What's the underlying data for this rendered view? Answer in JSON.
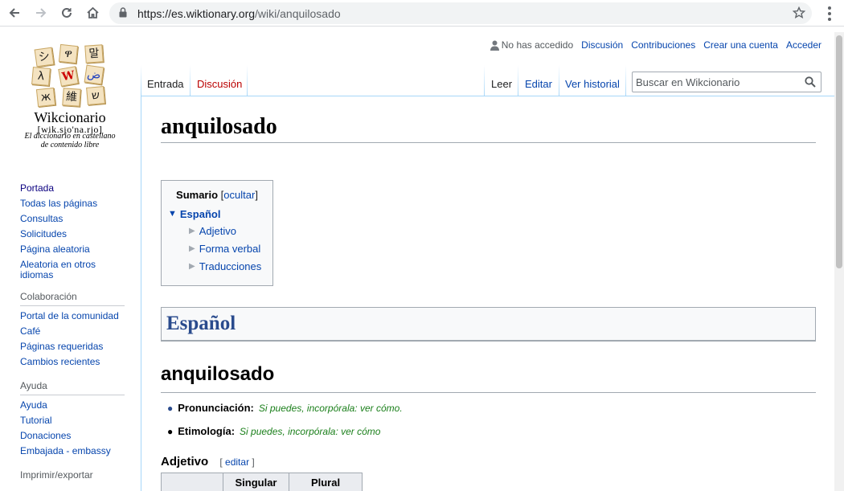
{
  "browser": {
    "url_host": "https://es.wiktionary.org",
    "url_path": "/wiki/anquilosado"
  },
  "logo": {
    "tiles": [
      "シ",
      "ዋ",
      "말",
      "λ",
      "W",
      "ض",
      "ж",
      "維",
      "ש"
    ],
    "title": "Wikcionario",
    "ipa": "[wik.sjo'na.rjo]",
    "subtitle_line1": "El diccionario  en castellano",
    "subtitle_line2": "de contenido libre"
  },
  "personal": {
    "anon": "No has accedido",
    "links": [
      "Discusión",
      "Contribuciones",
      "Crear una cuenta",
      "Acceder"
    ]
  },
  "tabs": {
    "left": [
      {
        "label": "Entrada",
        "selected": true
      },
      {
        "label": "Discusión",
        "selected": false
      }
    ],
    "right": [
      {
        "label": "Leer",
        "selected": true
      },
      {
        "label": "Editar",
        "selected": false
      },
      {
        "label": "Ver historial",
        "selected": false
      }
    ]
  },
  "search": {
    "placeholder": "Buscar en Wikcionario"
  },
  "sidebar": {
    "nav": [
      "Portada",
      "Todas las páginas",
      "Consultas",
      "Solicitudes",
      "Página aleatoria",
      "Aleatoria en otros idiomas"
    ],
    "collab_heading": "Colaboración",
    "collab": [
      "Portal de la comunidad",
      "Café",
      "Páginas requeridas",
      "Cambios recientes"
    ],
    "help_heading": "Ayuda",
    "help": [
      "Ayuda",
      "Tutorial",
      "Donaciones",
      "Embajada - embassy"
    ],
    "print_heading": "Imprimir/exportar"
  },
  "page": {
    "title": "anquilosado",
    "toc": {
      "title": "Sumario",
      "toggle_open": "[",
      "toggle_label": "ocultar",
      "toggle_close": "]",
      "l1": "Español",
      "l2": [
        "Adjetivo",
        "Forma verbal",
        "Traducciones"
      ]
    },
    "language": "Español",
    "word_heading": "anquilosado",
    "pronunciation_label": "Pronunciación:",
    "pronunciation_note": "Si puedes, incorpórala:",
    "pronunciation_link": "ver cómo.",
    "etymology_label": "Etimología:",
    "etymology_note": "Si puedes, incorpórala:",
    "etymology_link": "ver cómo",
    "pos_heading": "Adjetivo",
    "edit_open": "[",
    "edit_label": "editar",
    "edit_close": "]",
    "table_headers": [
      "",
      "Singular",
      "Plural"
    ]
  },
  "colors": {
    "link": "#0645ad",
    "new_link": "#ba0000",
    "note_green": "#1a7f1a",
    "heading_blue": "#2a4b8d"
  }
}
